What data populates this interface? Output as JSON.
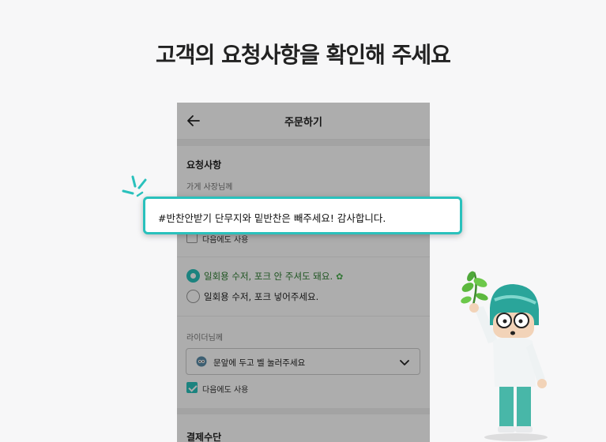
{
  "heading": "고객의 요청사항을 확인해 주세요",
  "app": {
    "title": "주문하기",
    "request_section_title": "요청사항",
    "store_label": "가게 사장님께",
    "store_reuse_label": "다음에도 사용",
    "radio_options": [
      {
        "label": "일회용 수저, 포크 안 주셔도 돼요.",
        "selected": true
      },
      {
        "label": "일회용 수저, 포크 넣어주세요.",
        "selected": false
      }
    ],
    "rider_label": "라이더님께",
    "rider_request": "문앞에 두고 벨 눌러주세요",
    "rider_reuse_label": "다음에도 사용",
    "payment_title": "결제수단"
  },
  "popup": {
    "text": "#반찬안받기 단무지와 밑반찬은 빼주세요! 감사합니다."
  },
  "colors": {
    "accent": "#2ac1bc",
    "overlay": "rgba(0,0,0,0.32)"
  }
}
